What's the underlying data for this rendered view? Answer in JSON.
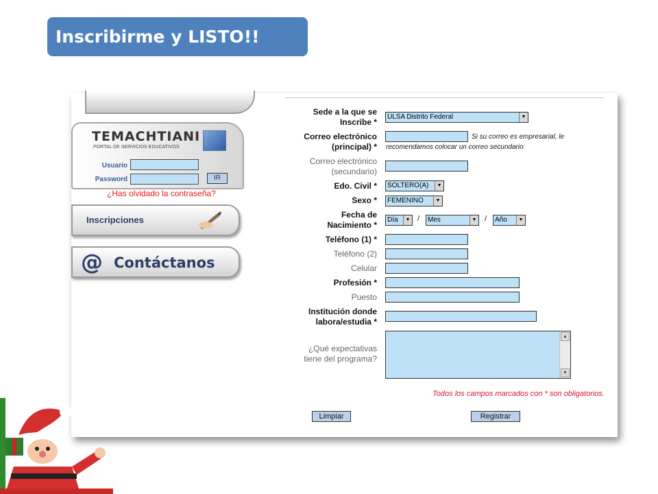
{
  "title": "Inscribirme y LISTO!!",
  "colors": {
    "banner": "#4f81bd",
    "field_bg": "#bfe1f7",
    "required_note": "#d8142d",
    "forgot": "#e01b1b"
  },
  "sidebar": {
    "logo": "TEMACHTIANI",
    "logo_sub": "PORTAL DE SERVICIOS EDUCATIVOS",
    "usuario_label": "Usuario",
    "password_label": "Password",
    "ir_label": "IR",
    "forgot_link": "¿Has olvidado la contraseña?",
    "inscripciones": "Inscripciones",
    "contact_at": "@",
    "contactanos": "Contáctanos"
  },
  "form": {
    "sede_label_1": "Sede a la que se",
    "sede_label_2": "Inscribe *",
    "sede_value": "ULSA Distrito Federal",
    "correo_label_1": "Correo electrónico",
    "correo_label_2": "(principal) *",
    "correo_note_1": "Si su correo es empresarial, le",
    "correo_note_2": "recomendamos colocar un correo secundario",
    "correo2_label_1": "Correo electrónico",
    "correo2_label_2": "(secundario)",
    "civil_label": "Edo. Civil *",
    "civil_value": "SOLTERO(A)",
    "sexo_label": "Sexo *",
    "sexo_value": "FEMENINO",
    "fecha_label_1": "Fecha de",
    "fecha_label_2": "Nacimiento *",
    "dia_value": "Día",
    "mes_value": "Mes",
    "anio_value": "Año",
    "slash": "/",
    "tel1_label": "Teléfono (1) *",
    "tel2_label": "Teléfono (2)",
    "celular_label": "Celular",
    "profesion_label": "Profesión *",
    "puesto_label": "Puesto",
    "inst_label_1": "Institución donde",
    "inst_label_2": "labora/estudia *",
    "expect_label_1": "¿Qué expectativas",
    "expect_label_2": "tiene del programa?",
    "required_note": "Todos los campos marcados con * son obligatorios.",
    "limpiar": "Limpiar",
    "registrar": "Registrar"
  }
}
